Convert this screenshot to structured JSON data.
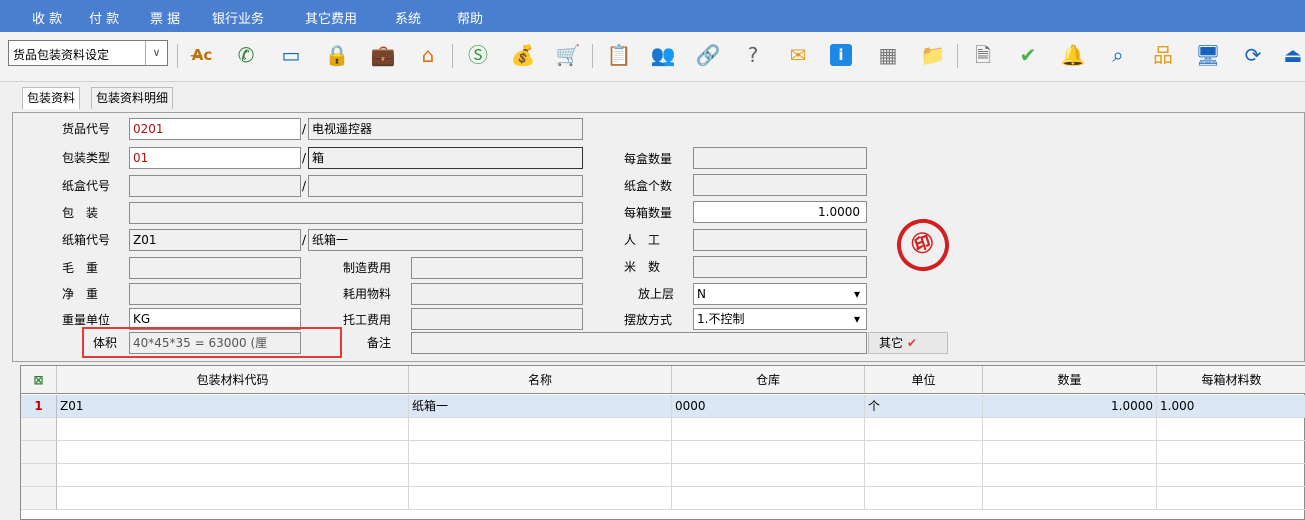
{
  "menu": [
    "收 款",
    "付 款",
    "票 据",
    "银行业务",
    "其它费用",
    "系统",
    "帮助"
  ],
  "toolbar": {
    "module_select": "货品包装资料设定",
    "icons": [
      "spellcheck-icon",
      "phone-icon",
      "monitor-icon",
      "lock-icon",
      "briefcase-icon",
      "home-icon",
      "dollar-icon",
      "money-bag-icon",
      "cart-icon",
      "clipboard-icon",
      "users-icon",
      "link-icon",
      "help-doc-icon",
      "mail-icon",
      "info-icon",
      "calculator-icon",
      "folder-icon",
      "document-icon",
      "check-circle-icon",
      "bell-icon",
      "search-icon",
      "org-chart-icon",
      "screen-icon",
      "refresh-icon",
      "exit-icon"
    ]
  },
  "tabs": [
    "包装资料",
    "包装资料明细"
  ],
  "form": {
    "item_code_label": "货品代号",
    "item_code": "0201",
    "item_name": "电视遥控器",
    "pack_type_label": "包装类型",
    "pack_type": "01",
    "pack_type_name": "箱",
    "carton_code_label": "纸盒代号",
    "carton_code": "",
    "carton_name": "",
    "package_label": "包　装",
    "package": "",
    "box_code_label": "纸箱代号",
    "box_code": "Z01",
    "box_name": "纸箱一",
    "gross_weight_label": "毛　重",
    "gross_weight": "",
    "net_weight_label": "净　重",
    "net_weight": "",
    "weight_unit_label": "重量单位",
    "weight_unit": "KG",
    "volume_label": "体积",
    "volume": "40*45*35 = 63000 (厘",
    "mfg_cost_label": "制造费用",
    "mfg_cost": "",
    "consumables_label": "耗用物料",
    "consumables": "",
    "consign_cost_label": "托工费用",
    "consign_cost": "",
    "remark_label": "备注",
    "remark": "",
    "qty_per_box_label": "每盒数量",
    "qty_per_box": "",
    "carton_count_label": "纸盒个数",
    "carton_count": "",
    "qty_per_case_label": "每箱数量",
    "qty_per_case": "1.0000",
    "labor_label": "人　工",
    "labor": "",
    "meters_label": "米　数",
    "meters": "",
    "top_layer_label": "放上层",
    "top_layer": "N",
    "placement_label": "摆放方式",
    "placement": "1.不控制",
    "other_label": "其它"
  },
  "grid": {
    "headers": [
      "包装材料代码",
      "名称",
      "仓库",
      "单位",
      "数量",
      "每箱材料数"
    ],
    "rows": [
      {
        "num": "1",
        "code": "Z01",
        "name": "纸箱一",
        "warehouse": "0000",
        "unit": "个",
        "qty": "1.0000",
        "per_box": "1.000"
      }
    ]
  }
}
